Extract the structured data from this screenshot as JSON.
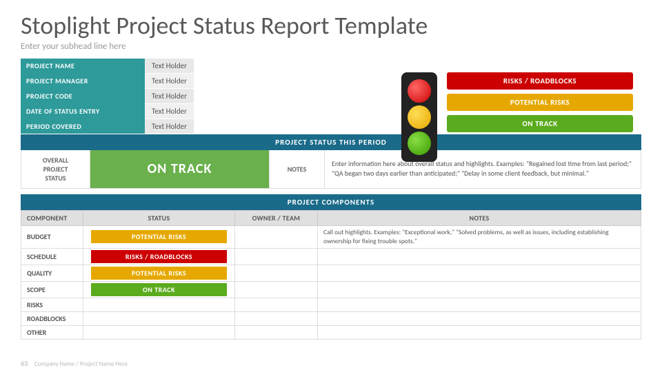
{
  "header": {
    "title": "Stoplight Project Status Report Template",
    "subhead": "Enter your subhead line here"
  },
  "info_rows": [
    {
      "label": "PROJECT NAME",
      "value": "Text Holder"
    },
    {
      "label": "PROJECT MANAGER",
      "value": "Text Holder"
    },
    {
      "label": "PROJECT CODE",
      "value": "Text Holder"
    },
    {
      "label": "DATE OF STATUS ENTRY",
      "value": "Text Holder"
    },
    {
      "label": "PERIOD COVERED",
      "value": "Text Holder"
    }
  ],
  "legend": {
    "risks_label": "RISKS / ROADBLOCKS",
    "potential_label": "POTENTIAL RISKS",
    "ontrack_label": "ON TRACK"
  },
  "status_section": {
    "header": "PROJECT STATUS THIS PERIOD",
    "overall_label": "OVERALL\nPROJECT\nSTATUS",
    "status_value": "ON TRACK",
    "notes_label": "NOTES",
    "notes_text": "Enter information here about overall status and highlights. Examples: \"Regained lost time from last period;\" \"QA began two days earlier than anticipated;\" \"Delay in some client feedback, but minimal.\""
  },
  "components_section": {
    "header": "PROJECT COMPONENTS",
    "columns": [
      "COMPONENT",
      "STATUS",
      "OWNER / TEAM",
      "NOTES"
    ],
    "rows": [
      {
        "component": "BUDGET",
        "status": "POTENTIAL RISKS",
        "status_type": "yellow",
        "owner": "",
        "notes": "Call out highlights. Examples: \"Exceptional work,\" \"Solved problems, as well as issues, including establishing ownership for fixing trouble spots.\""
      },
      {
        "component": "SCHEDULE",
        "status": "RISKS / ROADBLOCKS",
        "status_type": "red",
        "owner": "",
        "notes": ""
      },
      {
        "component": "QUALITY",
        "status": "POTENTIAL RISKS",
        "status_type": "yellow",
        "owner": "",
        "notes": ""
      },
      {
        "component": "SCOPE",
        "status": "ON TRACK",
        "status_type": "green",
        "owner": "",
        "notes": ""
      },
      {
        "component": "RISKS",
        "status": "",
        "status_type": "none",
        "owner": "",
        "notes": ""
      },
      {
        "component": "ROADBLOCKS",
        "status": "",
        "status_type": "none",
        "owner": "",
        "notes": ""
      },
      {
        "component": "OTHER",
        "status": "",
        "status_type": "none",
        "owner": "",
        "notes": ""
      }
    ]
  },
  "footer": {
    "page_number": "63",
    "company": "Company Name / Project Name Here"
  }
}
